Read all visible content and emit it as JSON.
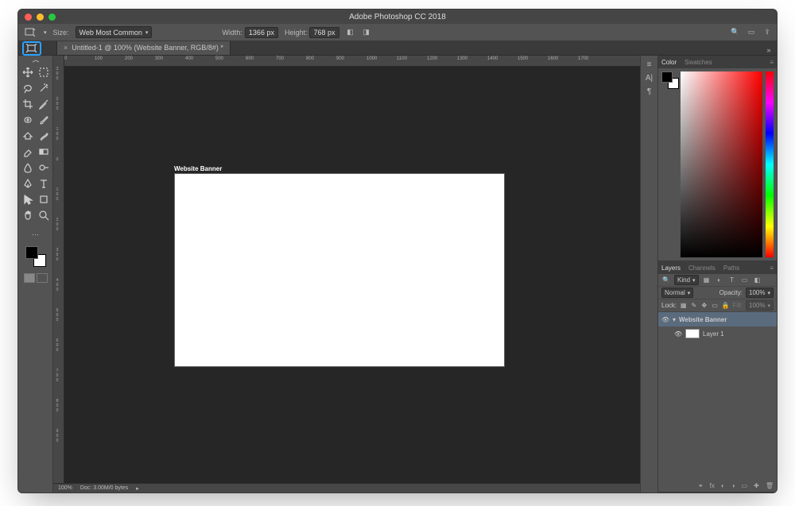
{
  "title": "Adobe Photoshop CC 2018",
  "option_bar": {
    "size_label": "Size:",
    "preset": "Web Most Common",
    "width_label": "Width:",
    "width_value": "1366 px",
    "height_label": "Height:",
    "height_value": "768 px"
  },
  "doc_tab": {
    "title": "Untitled-1 @ 100% (Website Banner, RGB/8#) *"
  },
  "ruler_h": [
    "0",
    "100",
    "200",
    "300",
    "400",
    "500",
    "600",
    "700",
    "800",
    "900",
    "1000",
    "1100",
    "1200",
    "1300",
    "1400",
    "1500",
    "1600",
    "1700"
  ],
  "ruler_v": [
    "0",
    "",
    "",
    "1\n0\n0",
    "",
    "",
    "2\n0\n0",
    "",
    "",
    "3\n0\n0",
    "",
    "",
    "4\n0\n0",
    "",
    "",
    "5\n0\n0",
    "",
    "",
    "6\n0\n0",
    "",
    "",
    "7\n0\n0",
    "",
    ""
  ],
  "canvas": {
    "artboard_name": "Website Banner"
  },
  "statusbar": {
    "zoom": "100%",
    "doc_info": "Doc: 3.00M/0 bytes"
  },
  "panels": {
    "color": {
      "tab_color": "Color",
      "tab_swatches": "Swatches"
    },
    "layers": {
      "tab_layers": "Layers",
      "tab_channels": "Channels",
      "tab_paths": "Paths",
      "kind_label": "Kind",
      "blend_mode": "Normal",
      "opacity_label": "Opacity:",
      "opacity_value": "100%",
      "lock_label": "Lock:",
      "fill_label": "Fill:",
      "fill_value": "100%",
      "group_name": "Website Banner",
      "layer1_name": "Layer 1"
    }
  },
  "footer_icons": {
    "link": "⚭",
    "fx": "fx",
    "mask": "◐",
    "adj": "◑",
    "group": "▭",
    "new": "✚",
    "trash": "🗑"
  }
}
